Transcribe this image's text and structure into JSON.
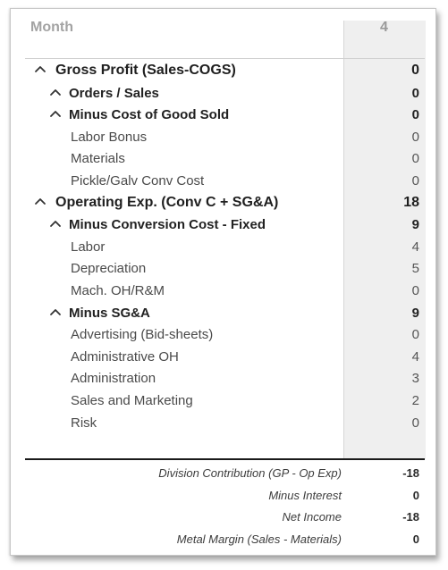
{
  "header": {
    "label": "Month",
    "value": "4"
  },
  "rows": [
    {
      "level": 0,
      "expandable": true,
      "icon": "chevron-up-icon",
      "label": "Gross Profit (Sales-COGS)",
      "value": "0"
    },
    {
      "level": 1,
      "expandable": true,
      "icon": "chevron-up-icon",
      "label": "Orders / Sales",
      "value": "0"
    },
    {
      "level": 1,
      "expandable": true,
      "icon": "chevron-up-icon",
      "label": "Minus Cost of Good Sold",
      "value": "0"
    },
    {
      "level": 2,
      "expandable": false,
      "label": "Labor Bonus",
      "value": "0"
    },
    {
      "level": 2,
      "expandable": false,
      "label": "Materials",
      "value": "0"
    },
    {
      "level": 2,
      "expandable": false,
      "label": "Pickle/Galv Conv Cost",
      "value": "0"
    },
    {
      "level": 0,
      "expandable": true,
      "icon": "chevron-up-icon",
      "label": "Operating Exp. (Conv C + SG&A)",
      "value": "18"
    },
    {
      "level": 1,
      "expandable": true,
      "icon": "chevron-up-icon",
      "label": "Minus Conversion Cost - Fixed",
      "value": "9"
    },
    {
      "level": 2,
      "expandable": false,
      "label": "Labor",
      "value": "4"
    },
    {
      "level": 2,
      "expandable": false,
      "label": "Depreciation",
      "value": "5"
    },
    {
      "level": 2,
      "expandable": false,
      "label": "Mach. OH/R&M",
      "value": "0"
    },
    {
      "level": 1,
      "expandable": true,
      "icon": "chevron-up-icon",
      "label": "Minus SG&A",
      "value": "9"
    },
    {
      "level": 2,
      "expandable": false,
      "label": "Advertising (Bid-sheets)",
      "value": "0"
    },
    {
      "level": 2,
      "expandable": false,
      "label": "Administrative OH",
      "value": "4"
    },
    {
      "level": 2,
      "expandable": false,
      "label": "Administration",
      "value": "3"
    },
    {
      "level": 2,
      "expandable": false,
      "label": "Sales and Marketing",
      "value": "2"
    },
    {
      "level": 2,
      "expandable": false,
      "label": "Risk",
      "value": "0"
    }
  ],
  "footer": [
    {
      "label": "Division Contribution (GP - Op Exp)",
      "value": "-18"
    },
    {
      "label": "Minus Interest",
      "value": "0"
    },
    {
      "label": "Net Income",
      "value": "-18"
    },
    {
      "label": "Metal Margin (Sales - Materials)",
      "value": "0"
    }
  ]
}
